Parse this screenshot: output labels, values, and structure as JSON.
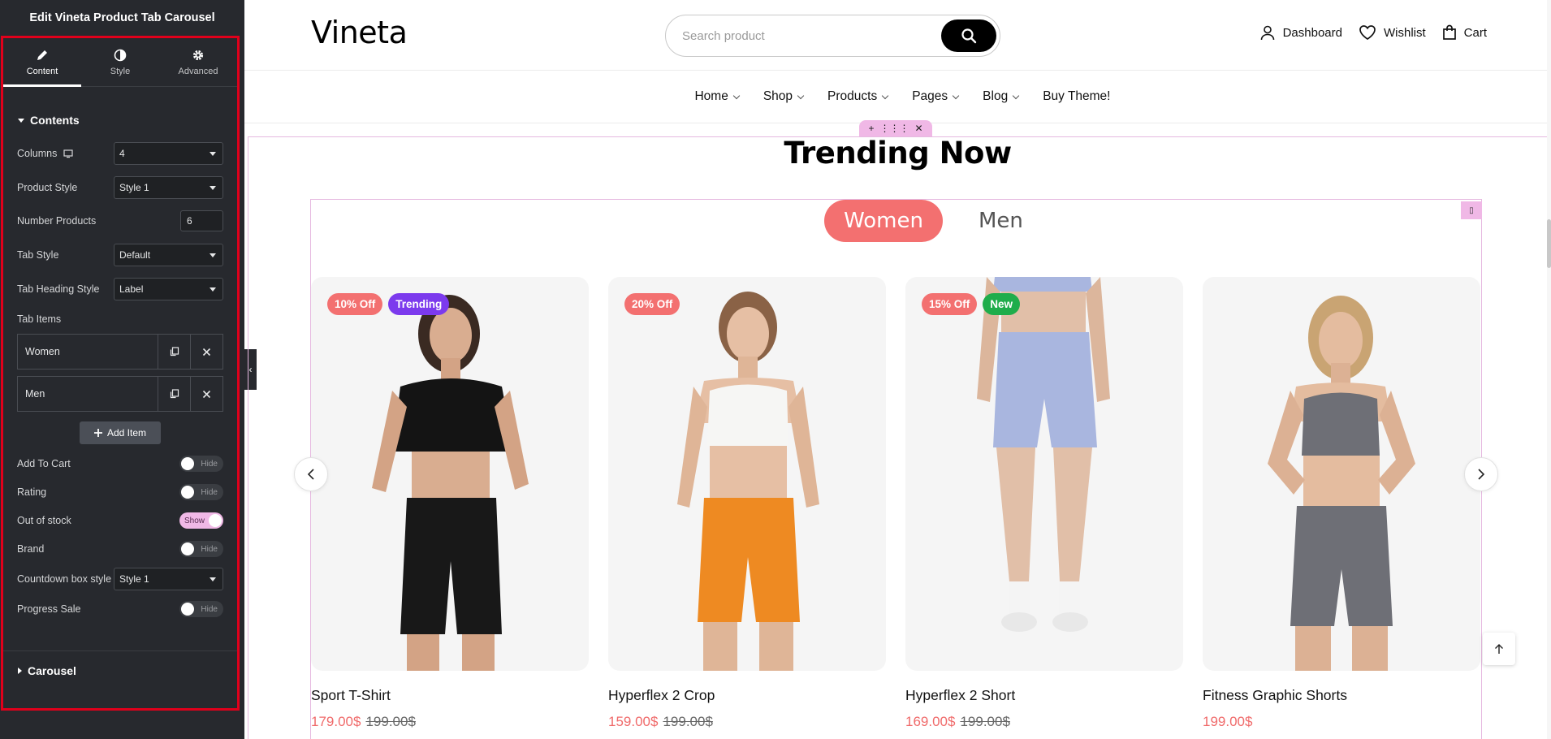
{
  "editor": {
    "title": "Edit Vineta Product Tab Carousel",
    "tabs": [
      {
        "label": "Content",
        "icon": "pencil-icon"
      },
      {
        "label": "Style",
        "icon": "half-circle-icon"
      },
      {
        "label": "Advanced",
        "icon": "gear-icon"
      }
    ],
    "contents_heading": "Contents",
    "controls": {
      "columns": {
        "label": "Columns",
        "value": "4"
      },
      "product_style": {
        "label": "Product Style",
        "value": "Style 1"
      },
      "number_products": {
        "label": "Number Products",
        "value": "6"
      },
      "tab_style": {
        "label": "Tab Style",
        "value": "Default"
      },
      "tab_heading_style": {
        "label": "Tab Heading Style",
        "value": "Label"
      },
      "tab_items_label": "Tab Items",
      "tab_items": [
        "Women",
        "Men"
      ],
      "add_item": "Add Item",
      "add_to_cart": {
        "label": "Add To Cart",
        "state": "Hide"
      },
      "rating": {
        "label": "Rating",
        "state": "Hide"
      },
      "out_of_stock": {
        "label": "Out of stock",
        "state": "Show"
      },
      "brand": {
        "label": "Brand",
        "state": "Hide"
      },
      "countdown": {
        "label": "Countdown box style",
        "value": "Style 1"
      },
      "progress_sale": {
        "label": "Progress Sale",
        "state": "Hide"
      }
    },
    "carousel_heading": "Carousel"
  },
  "site": {
    "logo": "Vineta",
    "search_placeholder": "Search product",
    "header_links": [
      "Dashboard",
      "Wishlist",
      "Cart"
    ],
    "nav": [
      "Home",
      "Shop",
      "Products",
      "Pages",
      "Blog",
      "Buy Theme!"
    ],
    "section_title": "Trending Now",
    "product_tabs": [
      "Women",
      "Men"
    ],
    "products": [
      {
        "name": "Sport T-Shirt",
        "price": "179.00$",
        "old_price": "199.00$",
        "badges": [
          {
            "text": "10% Off",
            "color": "#f37070"
          },
          {
            "text": "Trending",
            "color": "#7c3aed"
          }
        ]
      },
      {
        "name": "Hyperflex 2 Crop",
        "price": "159.00$",
        "old_price": "199.00$",
        "badges": [
          {
            "text": "20% Off",
            "color": "#f37070"
          }
        ]
      },
      {
        "name": "Hyperflex 2 Short",
        "price": "169.00$",
        "old_price": "199.00$",
        "badges": [
          {
            "text": "15% Off",
            "color": "#f37070"
          },
          {
            "text": "New",
            "color": "#1fad4b"
          }
        ]
      },
      {
        "name": "Fitness Graphic Shorts",
        "price": "199.00$",
        "old_price": "",
        "badges": []
      }
    ]
  },
  "colors": {
    "accent": "#f37070",
    "editor_bg": "#27292e",
    "highlight": "#f0b8e6"
  }
}
